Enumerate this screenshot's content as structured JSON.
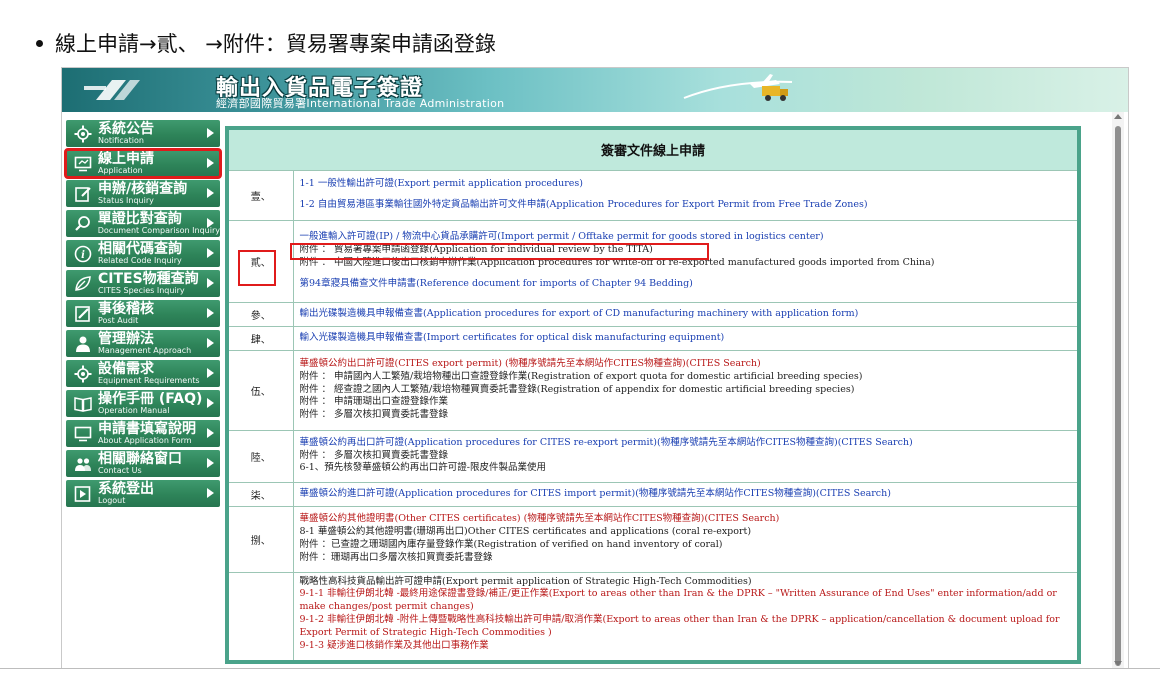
{
  "heading": {
    "text": "線上申請→貳、 →附件：貿易署專案申請函登錄"
  },
  "banner": {
    "title_zh": "輸出入貨品電子簽證",
    "title_en": "經濟部國際貿易署International Trade Administration"
  },
  "sidebar": {
    "items": [
      {
        "zh": "系統公告",
        "en": "Notification",
        "icon": "gear-icon"
      },
      {
        "zh": "線上申請",
        "en": "Application",
        "icon": "monitor-icon"
      },
      {
        "zh": "申辦/核銷查詢",
        "en": "Status Inquiry",
        "icon": "edit-icon"
      },
      {
        "zh": "單證比對查詢",
        "en": "Document Comparison Inquiry",
        "icon": "search-icon"
      },
      {
        "zh": "相關代碼查詢",
        "en": "Related Code Inquiry",
        "icon": "info-icon"
      },
      {
        "zh": "CITES物種查詢",
        "en": "CITES Species Inquiry",
        "icon": "leaf-icon"
      },
      {
        "zh": "事後稽核",
        "en": "Post Audit",
        "icon": "pencil-icon"
      },
      {
        "zh": "管理辦法",
        "en": "Management Approach",
        "icon": "person-icon"
      },
      {
        "zh": "設備需求",
        "en": "Equipment Requirements",
        "icon": "gear-icon"
      },
      {
        "zh": "操作手冊 (FAQ)",
        "en": "Operation Manual",
        "icon": "book-icon"
      },
      {
        "zh": "申請書填寫說明",
        "en": "About Application Form",
        "icon": "monitor-icon"
      },
      {
        "zh": "相關聯絡窗口",
        "en": "Contact Us",
        "icon": "people-icon"
      },
      {
        "zh": "系統登出",
        "en": "Logout",
        "icon": "logout-icon"
      }
    ]
  },
  "table": {
    "header": "簽審文件線上申請",
    "rows": [
      {
        "num": "壹、",
        "lines": [
          {
            "text": "1-1 一般性輸出許可證(Export permit application procedures)",
            "style": "lnk"
          },
          {
            "text": " ",
            "style": "plain"
          },
          {
            "text": "1-2 自由貿易港區事業輸往國外特定貨品輸出許可文件申請(Application Procedures for Export Permit from Free Trade Zones)",
            "style": "lnk"
          }
        ]
      },
      {
        "num": "貳、",
        "lines": [
          {
            "text": "一般進輸入許可證(IP) / 物流中心貨品承購許可(Import permit / Offtake permit for goods stored in logistics center)",
            "style": "lnk"
          },
          {
            "text": "附件 ： 貿易署專案申請函登錄(Application for individual review by the TITA)",
            "style": "plain"
          },
          {
            "text": "附件 ： 中國大陸進口後出口核銷申辦作業(Application procedures for write-off of re-exported manufactured goods imported from China)",
            "style": "plain"
          },
          {
            "text": " ",
            "style": "plain"
          },
          {
            "text": "第94章寢具備查文件申請書(Reference document for imports of Chapter 94 Bedding)",
            "style": "lnk"
          }
        ]
      },
      {
        "num": "參、",
        "lines": [
          {
            "text": "輸出光碟製造機具申報備查書(Application procedures for export of CD manufacturing machinery with application form)",
            "style": "lnk"
          }
        ]
      },
      {
        "num": "肆、",
        "lines": [
          {
            "text": "輸入光碟製造機具申報備查書(Import certificates for optical disk manufacturing equipment)",
            "style": "lnk"
          }
        ]
      },
      {
        "num": "伍、",
        "lines": [
          {
            "text": "華盛頓公約出口許可證(CITES export permit) (物種序號請先至本網站作CITES物種查詢)(CITES Search)",
            "style": "red"
          },
          {
            "text": "附件 ： 申請國內人工繁殖/栽培物種出口查證登錄作業(Registration of export quota for domestic artificial breeding species)",
            "style": "plain"
          },
          {
            "text": "附件 ： 經查證之國內人工繁殖/栽培物種買賣委託書登錄(Registration of appendix for domestic artificial breeding species)",
            "style": "plain"
          },
          {
            "text": "附件 ： 申請珊瑚出口查證登錄作業",
            "style": "plain"
          },
          {
            "text": "附件 ： 多層次核扣買賣委託書登錄",
            "style": "plain"
          }
        ]
      },
      {
        "num": "陸、",
        "lines": [
          {
            "text": "華盛頓公約再出口許可證(Application procedures for CITES re-export permit)(物種序號請先至本網站作CITES物種查詢)(CITES Search)",
            "style": "lnk"
          },
          {
            "text": "附件 ： 多層次核扣買賣委託書登錄",
            "style": "plain"
          },
          {
            "text": "6-1、預先核發華盛頓公約再出口許可證-限皮件製品業使用",
            "style": "plain"
          }
        ]
      },
      {
        "num": "柒、",
        "lines": [
          {
            "text": "華盛頓公約進口許可證(Application procedures for CITES import permit)(物種序號請先至本網站作CITES物種查詢)(CITES Search)",
            "style": "lnk"
          }
        ]
      },
      {
        "num": "捌、",
        "lines": [
          {
            "text": "華盛頓公約其他證明書(Other CITES certificates) (物種序號請先至本網站作CITES物種查詢)(CITES Search)",
            "style": "red"
          },
          {
            "text": "8-1 華盛頓公約其他證明書(珊瑚再出口)Other CITES certificates and applications (coral re-export)",
            "style": "plain"
          },
          {
            "text": "附件 ：已查證之珊瑚國內庫存量登錄作業(Registration of verified on hand inventory of coral)",
            "style": "plain"
          },
          {
            "text": "附件 ：珊瑚再出口多層次核扣買賣委託書登錄",
            "style": "plain"
          }
        ]
      },
      {
        "num": "",
        "lines": [
          {
            "text": "戰略性高科技貨品輸出許可證申請(Export permit application of Strategic High-Tech Commodities)",
            "style": "plain"
          },
          {
            "text": "9-1-1 非輸往伊朗北韓 -最終用途保證書登錄/補正/更正作業(Export to areas other than Iran & the DPRK – \"Written Assurance of End Uses\" enter information/add or make changes/post permit changes)",
            "style": "red"
          },
          {
            "text": "9-1-2 非輸往伊朗北韓 -附件上傳暨戰略性高科技輸出許可申請/取消作業(Export to areas other than Iran & the DPRK – application/cancellation & document upload for Export Permit of Strategic High-Tech Commodities )",
            "style": "red"
          },
          {
            "text": "9-1-3 疑涉進口核銷作業及其他出口事務作業",
            "style": "red"
          }
        ]
      }
    ]
  }
}
